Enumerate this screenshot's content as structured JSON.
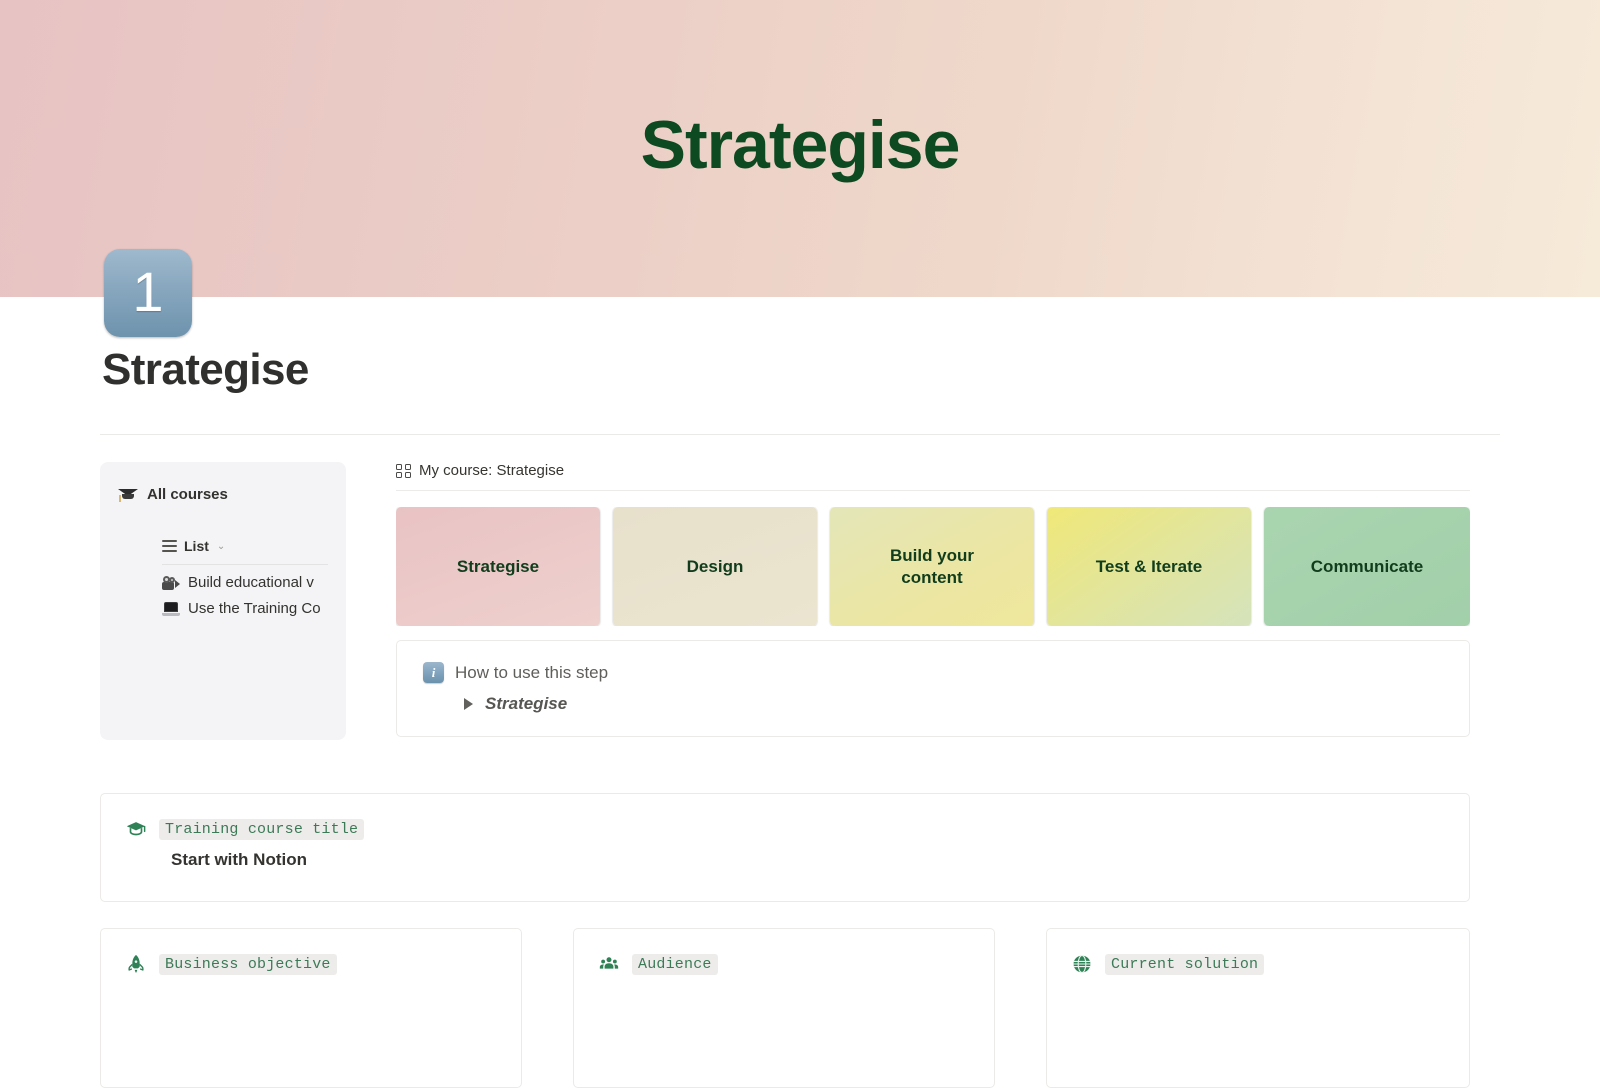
{
  "cover": {
    "title": "Strategise",
    "title_color": "#0d4a22",
    "gradient_from": "#e7c3c3",
    "gradient_to": "#f6ead9"
  },
  "page": {
    "icon": "keycap-one-emoji",
    "icon_digit": "1",
    "title": "Strategise"
  },
  "sidebar": {
    "header": {
      "icon": "graduation-cap-emoji",
      "label": "All courses"
    },
    "view": {
      "icon": "list-view-icon",
      "label": "List",
      "chevron": "⌄"
    },
    "items": [
      {
        "icon": "movie-camera-emoji",
        "label": "Build educational v"
      },
      {
        "icon": "laptop-emoji",
        "label": "Use the Training Co"
      }
    ]
  },
  "database": {
    "icon": "gallery-view-icon",
    "title": "My course: Strategise",
    "cards": [
      {
        "label": "Strategise",
        "color_from": "#e9c3c4",
        "color_to": "#eed0cd"
      },
      {
        "label": "Design",
        "color_from": "#e7e0cb",
        "color_to": "#e9e4cd"
      },
      {
        "label": "Build your\ncontent",
        "color_from": "#e6e7b8",
        "color_to": "#efe79c"
      },
      {
        "label": "Test & Iterate",
        "color_from": "#f0e878",
        "color_to": "#d7e4bc"
      },
      {
        "label": "Communicate",
        "color_from": "#a8d3ae",
        "color_to": "#9fcfa8"
      }
    ],
    "card_text_color": "#113d1c"
  },
  "howto": {
    "icon": "information-emoji",
    "title": "How to use this step",
    "toggle": {
      "arrow": "▶",
      "label": "Strategise"
    }
  },
  "title_property": {
    "icon": "graduation-cap-icon",
    "label": "Training course title",
    "value": "Start with Notion"
  },
  "properties": [
    {
      "icon": "rocket-icon",
      "label": "Business objective",
      "text": ""
    },
    {
      "icon": "people-icon",
      "label": "Audience",
      "text": ""
    },
    {
      "icon": "globe-icon",
      "label": "Current solution",
      "text": ""
    }
  ],
  "accent": {
    "green": "#3c7a57",
    "code_bg": "#edecea"
  }
}
